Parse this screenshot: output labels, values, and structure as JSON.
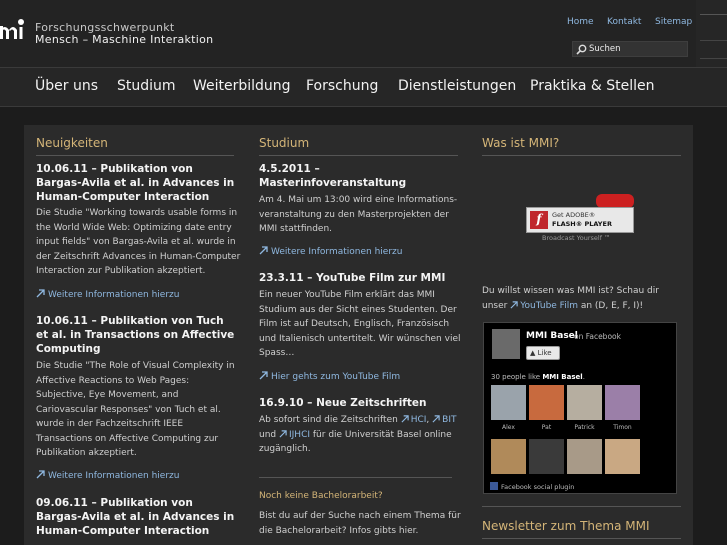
{
  "header": {
    "logo_line1": "Forschungsschwerpunkt",
    "logo_line2": "Mensch – Maschine  Interaktion",
    "links": [
      "Home",
      "Kontakt",
      "Sitemap"
    ],
    "search_label": "Suchen"
  },
  "nav": [
    "Über uns",
    "Studium",
    "Weiterbildung",
    "Forschung",
    "Dienstleistungen",
    "Praktika & Stellen"
  ],
  "news": {
    "title": "Neuigkeiten",
    "items": [
      {
        "headline": [
          "10.06.11 – Publikation von",
          "Bargas-Avila et al. in Advances in",
          "Human-Computer Interaction"
        ],
        "body": [
          "Die Studie \"Working towards usable forms in",
          "the World Wide Web: Optimizing date entry",
          "input fields\" von Bargas-Avila et al. wurde in",
          "der Zeitschrift Advances in Human-Computer",
          "Interaction zur Publikation akzeptiert."
        ],
        "more": "Weitere Informationen hierzu"
      },
      {
        "headline": [
          "10.06.11 – Publikation von Tuch",
          "et al. in Transactions on Affective",
          "Computing"
        ],
        "body": [
          "Die Studie \"The Role of Visual Complexity in",
          "Affective Reactions to Web Pages:",
          "Subjective, Eye Movement, and",
          "Cariovascular Responses\" von Tuch et al.",
          "wurde in der Fachzeitschrift IEEE",
          "Transactions on Affective Computing zur",
          "Publikation akzeptiert."
        ],
        "more": "Weitere Informationen hierzu"
      },
      {
        "headline": [
          "09.06.11 – Publikation von",
          "Bargas-Avila et al. in Advances in",
          "Human-Computer Interaction"
        ]
      }
    ]
  },
  "studium": {
    "title": "Studium",
    "item1": {
      "headline": [
        "4.5.2011 –",
        "Masterinfoveranstaltung"
      ],
      "body": [
        "Am 4. Mai um 13:00 wird eine Informations-",
        "veranstaltung  zu den Masterprojekten der",
        "MMI stattfinden."
      ],
      "more": "Weitere Informationen hierzu"
    },
    "item2": {
      "headline": "23.3.11 – YouTube Film zur MMI",
      "body": [
        "Ein neuer YouTube Film erklärt das MMI",
        "Studium aus der Sicht eines Studenten. Der",
        "Film ist auf Deutsch, Englisch, Französisch",
        "und Italienisch untertitelt. Wir wünschen viel",
        "Spass…"
      ],
      "more": "Hier gehts zum YouTube Film"
    },
    "item3": {
      "headline": "16.9.10 – Neue Zeitschriften",
      "line1_pre": "Ab sofort sind die Zeitschriften",
      "link_hci": "HCI",
      "sep": ",",
      "link_bit": "BIT",
      "line2_pre": "und",
      "link_ijhci": "IJHCI",
      "line2_post": "für die Universität Basel online",
      "line3": "zugänglich."
    },
    "bachelor": {
      "title": "Noch keine Bachelorarbeit?",
      "body": [
        "Bist du auf der Suche nach einem Thema für",
        "die Bachelorarbeit? Infos gibts hier."
      ]
    }
  },
  "mmi": {
    "title": "Was ist MMI?",
    "flash_get": "Get ADOBE®",
    "flash_player": "FLASH® PLAYER",
    "broadcast": "Broadcast Yourself ™",
    "line1": "Du willst wissen was MMI ist? Schau dir",
    "line2_pre": "unser",
    "youtube_link": "YouTube Film",
    "line2_post": "an (D, E, F, I)!",
    "newsletter_title": "Newsletter zum Thema MMI"
  },
  "facebook": {
    "page_name": "MMI Basel",
    "on": "on Facebook",
    "like": "Like",
    "count_pre": "30 people like",
    "count_name": "MMI Basel",
    "count_post": ".",
    "faces": [
      "Alex",
      "Pat",
      "Patrick",
      "Timon",
      "",
      "",
      "",
      ""
    ],
    "footer": "Facebook social plugin"
  },
  "colors": {
    "accent": "#d4b578",
    "link": "#8fb8e0",
    "background": "#1c1c1c",
    "panel": "#2b2b2b"
  }
}
